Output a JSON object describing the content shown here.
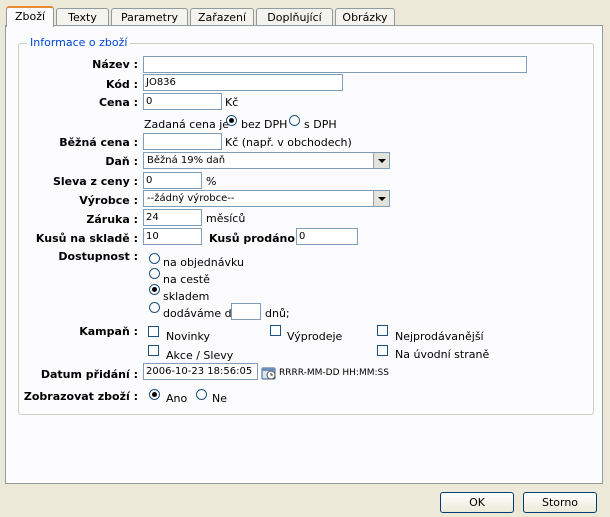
{
  "tabs": [
    "Zboží",
    "Texty",
    "Parametry",
    "Zařazení",
    "Doplňující",
    "Obrázky"
  ],
  "fieldset": {
    "legend": "Informace o zboží"
  },
  "fields": {
    "nazev": {
      "label": "Název :",
      "value": ""
    },
    "kod": {
      "label": "Kód :",
      "value": "JO836"
    },
    "cena": {
      "label": "Cena :",
      "value": "0",
      "unit": "Kč"
    },
    "zadana_cena": {
      "text": "Zadaná cena je",
      "opt_bez": "bez DPH",
      "opt_s": "s DPH",
      "selected": "bez DPH"
    },
    "bezna_cena": {
      "label": "Běžná cena :",
      "value": "",
      "unit": "Kč (např. v obchodech)"
    },
    "dan": {
      "label": "Daň :",
      "value": "Běžná 19% daň"
    },
    "sleva": {
      "label": "Sleva z ceny :",
      "value": "0",
      "unit": "%"
    },
    "vyrobce": {
      "label": "Výrobce :",
      "value": "--žádný výrobce--"
    },
    "zaruka": {
      "label": "Záruka :",
      "value": "24",
      "unit": "měsíců"
    },
    "kusu_skladem": {
      "label": "Kusů na skladě :",
      "value": "10"
    },
    "kusu_prodano": {
      "label": "Kusů prodáno :",
      "value": "0"
    },
    "dostupnost": {
      "label": "Dostupnost :",
      "options": [
        "na objednávku",
        "na cestě",
        "skladem",
        "dodáváme do"
      ],
      "selected": "skladem",
      "days_value": "",
      "days_unit": "dnů;"
    },
    "kampan": {
      "label": "Kampaň :",
      "options": [
        "Novinky",
        "Výprodeje",
        "Nejprodávanější",
        "Akce / Slevy",
        "Na úvodní straně"
      ]
    },
    "datum": {
      "label": "Datum přidání :",
      "value": "2006-10-23 18:56:05",
      "format": "RRRR-MM-DD HH:MM:SS"
    },
    "zobrazovat": {
      "label": "Zobrazovat zboží :",
      "opt_ano": "Ano",
      "opt_ne": "Ne",
      "selected": "Ano"
    }
  },
  "buttons": {
    "ok": "OK",
    "cancel": "Storno"
  }
}
